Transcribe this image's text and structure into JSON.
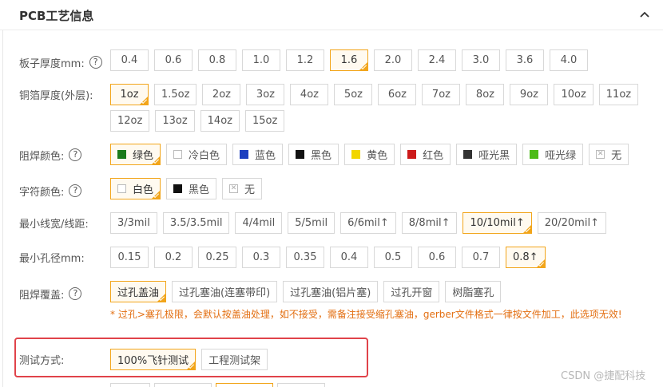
{
  "section": {
    "title": "PCB工艺信息",
    "collapse_icon": "chevron-up-icon"
  },
  "rows": {
    "thickness": {
      "label": "板子厚度mm:",
      "options": [
        "0.4",
        "0.6",
        "0.8",
        "1.0",
        "1.2",
        "1.6",
        "2.0",
        "2.4",
        "3.0",
        "3.6",
        "4.0"
      ],
      "selected": "1.6"
    },
    "copper": {
      "label": "铜箔厚度(外层):",
      "options": [
        "1oz",
        "1.5oz",
        "2oz",
        "3oz",
        "4oz",
        "5oz",
        "6oz",
        "7oz",
        "8oz",
        "9oz",
        "10oz",
        "11oz",
        "12oz",
        "13oz",
        "14oz",
        "15oz"
      ],
      "selected": "1oz"
    },
    "mask_color": {
      "label": "阻焊颜色:",
      "options": [
        {
          "text": "绿色",
          "color": "#1a7a1a"
        },
        {
          "text": "冷白色",
          "color": "#ffffff"
        },
        {
          "text": "蓝色",
          "color": "#1c3fbf"
        },
        {
          "text": "黑色",
          "color": "#111111"
        },
        {
          "text": "黄色",
          "color": "#f2d600"
        },
        {
          "text": "红色",
          "color": "#cc1a1a"
        },
        {
          "text": "哑光黑",
          "color": "#333333"
        },
        {
          "text": "哑光绿",
          "color": "#4cbb17"
        },
        {
          "text": "无",
          "color": "none"
        }
      ],
      "selected": "绿色"
    },
    "silk_color": {
      "label": "字符颜色:",
      "options": [
        {
          "text": "白色",
          "color": "#ffffff"
        },
        {
          "text": "黑色",
          "color": "#111111"
        },
        {
          "text": "无",
          "color": "none"
        }
      ],
      "selected": "白色"
    },
    "trace": {
      "label": "最小线宽/线距:",
      "options": [
        "3/3mil",
        "3.5/3.5mil",
        "4/4mil",
        "5/5mil",
        "6/6mil↑",
        "8/8mil↑",
        "10/10mil↑",
        "20/20mil↑"
      ],
      "selected": "10/10mil↑"
    },
    "hole": {
      "label": "最小孔径mm:",
      "options": [
        "0.15",
        "0.2",
        "0.25",
        "0.3",
        "0.35",
        "0.4",
        "0.5",
        "0.6",
        "0.7",
        "0.8↑"
      ],
      "selected": "0.8↑"
    },
    "via": {
      "label": "阻焊覆盖:",
      "options": [
        "过孔盖油",
        "过孔塞油(连塞带印)",
        "过孔塞油(铝片塞)",
        "过孔开窗",
        "树脂塞孔"
      ],
      "selected": "过孔盖油",
      "note": "* 过孔>塞孔极限，会默认按盖油处理，如不接受，需备注接受缩孔塞油，gerber文件格式一律按文件加工，此选项无效!"
    },
    "test": {
      "label": "测试方式:",
      "options": [
        "100%飞针测试",
        "工程测试架"
      ],
      "selected": "100%飞针测试"
    }
  },
  "watermark": "CSDN @捷配科技"
}
